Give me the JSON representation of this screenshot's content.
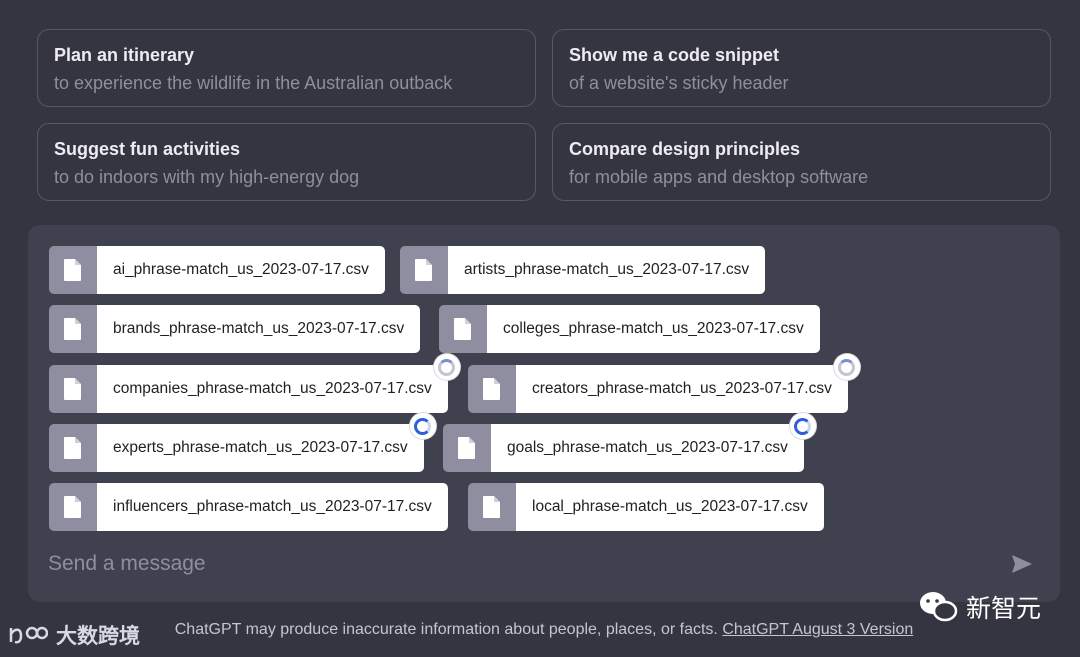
{
  "suggestions": [
    {
      "title": "Plan an itinerary",
      "subtitle": "to experience the wildlife in the Australian outback"
    },
    {
      "title": "Show me a code snippet",
      "subtitle": "of a website's sticky header"
    },
    {
      "title": "Suggest fun activities",
      "subtitle": "to do indoors with my high-energy dog"
    },
    {
      "title": "Compare design principles",
      "subtitle": "for mobile apps and desktop software"
    }
  ],
  "files": [
    {
      "name": "ai_phrase-match_us_2023-07-17.csv",
      "status": "done"
    },
    {
      "name": "artists_phrase-match_us_2023-07-17.csv",
      "status": "done"
    },
    {
      "name": "brands_phrase-match_us_2023-07-17.csv",
      "status": "done"
    },
    {
      "name": "colleges_phrase-match_us_2023-07-17.csv",
      "status": "done"
    },
    {
      "name": "companies_phrase-match_us_2023-07-17.csv",
      "status": "uploading-start"
    },
    {
      "name": "creators_phrase-match_us_2023-07-17.csv",
      "status": "uploading-start"
    },
    {
      "name": "experts_phrase-match_us_2023-07-17.csv",
      "status": "uploading"
    },
    {
      "name": "goals_phrase-match_us_2023-07-17.csv",
      "status": "uploading"
    },
    {
      "name": "influencers_phrase-match_us_2023-07-17.csv",
      "status": "done"
    },
    {
      "name": "local_phrase-match_us_2023-07-17.csv",
      "status": "done"
    }
  ],
  "composer": {
    "placeholder": "Send a message"
  },
  "footer": {
    "text": "ChatGPT may produce inaccurate information about people, places, or facts.",
    "link": "ChatGPT August 3 Version"
  },
  "watermarks": {
    "left": "大数跨境",
    "right": "新智元"
  },
  "colors": {
    "background": "#343541",
    "composer": "#40414f",
    "spinner_accent": "#2b60d6"
  }
}
